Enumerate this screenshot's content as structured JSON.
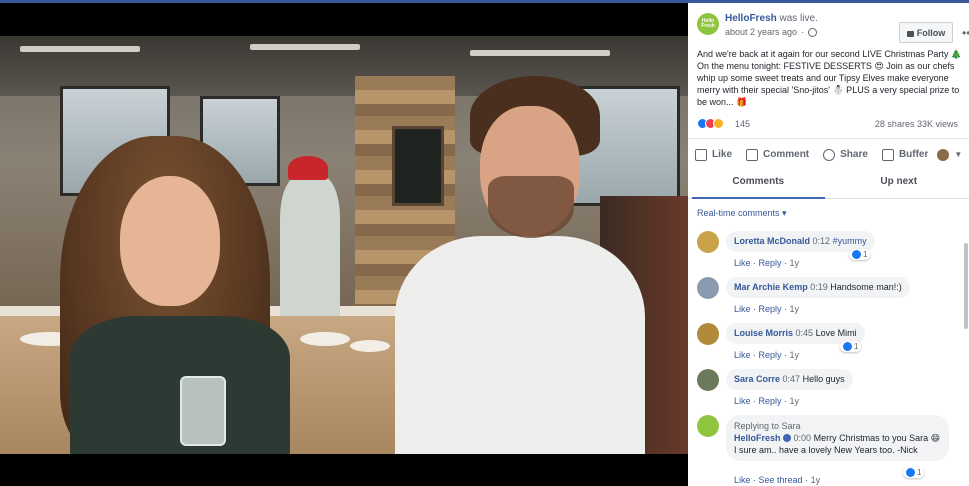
{
  "post": {
    "page_name": "HelloFresh",
    "status": "was live.",
    "time": "about 2 years ago",
    "follow_label": "Follow",
    "more_label": "•••",
    "logo_text": "Hello Fresh",
    "body": "And we're back at it again for our second LIVE Christmas Party 🎄 On the menu tonight: FESTIVE DESSERTS 😍 Join as our chefs whip up some sweet treats and our Tipsy Elves make everyone merry with their special 'Sno-jitos' ☃️ PLUS a very special prize to be won... 🎁"
  },
  "stats": {
    "reaction_count": "145",
    "shares": "28 shares",
    "views": "33K views"
  },
  "actions": {
    "like": "Like",
    "comment": "Comment",
    "share": "Share",
    "buffer": "Buffer"
  },
  "tabs": {
    "comments": "Comments",
    "up_next": "Up next"
  },
  "filter_label": "Real-time comments ▾",
  "comments": [
    {
      "name": "Loretta McDonald",
      "time": "0:12",
      "text": "#yummy",
      "reactions": "1",
      "like": "Like",
      "reply": "Reply",
      "ago": "1y",
      "avatar_color": "#c9a24a"
    },
    {
      "name": "Mar Archie Kemp",
      "time": "0:19",
      "text": "Handsome man!:)",
      "reactions": "",
      "like": "Like",
      "reply": "Reply",
      "ago": "1y",
      "avatar_color": "#8c9ab0"
    },
    {
      "name": "Louise Morris",
      "time": "0:45",
      "text": "Love Mimi",
      "reactions": "1",
      "like": "Like",
      "reply": "Reply",
      "ago": "1y",
      "avatar_color": "#b08a3a"
    },
    {
      "name": "Sara Corre",
      "time": "0:47",
      "text": "Hello guys",
      "reactions": "",
      "like": "Like",
      "reply": "Reply",
      "ago": "1y",
      "avatar_color": "#6a7a5a"
    }
  ],
  "reply": {
    "replying_to": "Replying to Sara",
    "name": "HelloFresh",
    "time": "0:00",
    "text": "Merry Christmas to you Sara 😄 I sure am.. have a lovely New Years too. -Nick",
    "reactions": "1",
    "like": "Like",
    "see_thread": "See thread",
    "ago": "1y"
  },
  "colors": {
    "accent": "#365899",
    "brand_green": "#8fc43f",
    "top_bar": "#3b5998"
  }
}
